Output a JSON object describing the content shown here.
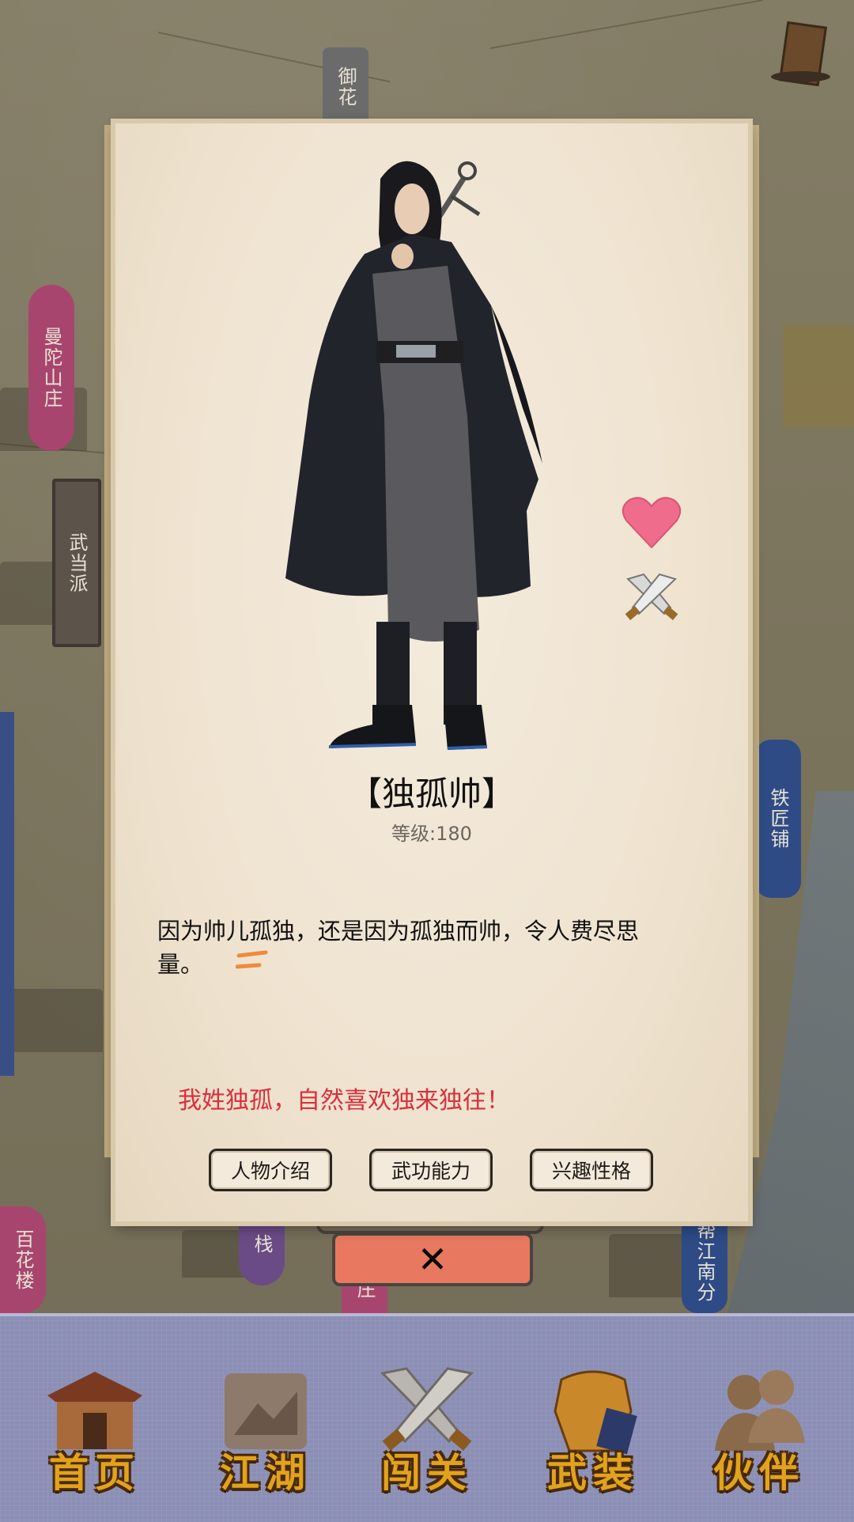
{
  "map": {
    "places": [
      {
        "name": "御花",
        "style": "grey"
      },
      {
        "name": "曼陀山庄",
        "style": "pink"
      },
      {
        "name": "武当派",
        "style": "dark"
      },
      {
        "name": "铁匠铺",
        "style": "blue"
      },
      {
        "name": "帮江南分",
        "style": "blue"
      },
      {
        "name": "百花楼",
        "style": "pink"
      },
      {
        "name": "栈",
        "style": "purple"
      },
      {
        "name": "庄",
        "style": "pink"
      }
    ]
  },
  "character": {
    "name": "【独孤帅】",
    "level": "等级:180",
    "description": "因为帅儿孤独，还是因为孤独而帅，令人费尽思量。",
    "quote": "我姓独孤，自然喜欢独来独往！"
  },
  "icons": {
    "favorite": "heart-icon",
    "battle": "crossed-swords-icon",
    "close": "close-icon"
  },
  "tabs": [
    {
      "label": "人物介绍"
    },
    {
      "label": "武功能力"
    },
    {
      "label": "兴趣性格"
    }
  ],
  "close_label": "✕",
  "bottom_nav": [
    {
      "label": "首页"
    },
    {
      "label": "江湖"
    },
    {
      "label": "闯关"
    },
    {
      "label": "武装"
    },
    {
      "label": "伙伴"
    }
  ],
  "colors": {
    "quote": "#d8303c",
    "close_button": "#e8785f",
    "nav_bar": "#8c8fb5",
    "nav_label": "#e1a31c",
    "heart": "#f06c8d"
  }
}
